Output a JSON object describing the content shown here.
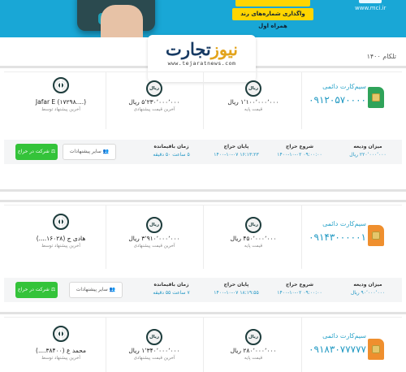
{
  "banner": {
    "promo_text": "واگذاری شماره‌های رند همراه اول",
    "site": "www.mci.ir"
  },
  "logo": {
    "main_left": "تجارت",
    "main_right": "نیوز",
    "sub": "www.tejaratnews.com"
  },
  "page": {
    "year_label": "تلکام ۱۴۰۰"
  },
  "labels": {
    "base_price": "قیمت پایه",
    "last_offer": "آخرین قیمت پیشنهادی",
    "last_offer_by": "آخرین پیشنهاد توسط",
    "deposit": "میزان ودیعه",
    "auction_start": "شروع حراج",
    "auction_end": "پایان حراج",
    "time_left": "زمان باقیمانده",
    "other_offers_button": "سایر پیشنهادات",
    "join_auction_button": "شرکت در حراج",
    "rial_icon_text": "ریال"
  },
  "cards": [
    {
      "sim_type": "سیم‌کارت دائمی",
      "sim_number": "۰۹۱۲۰۵۷۰۰۰۰",
      "base_price": "۱٬۱۰۰٬۰۰۰٬۰۰۰ ریال",
      "last_offer": "۵٬۲۳۰٬۰۰۰٬۰۰۰ ریال",
      "bidder": "Jafar E (۱۷۲۹۸....)",
      "deposit": "۲۲۰٬۰۰۰٬۰۰۰ ریال",
      "start": "۰۹:۰۰:۰۰ ۱۴۰۰-۱۰-۰۲",
      "end": "۱۶:۱۳:۲۳ ۱۴۰۰-۱۰-۰۷",
      "time_left": "۵ ساعت ۵۰ دقیقه",
      "sim_color": "green"
    },
    {
      "sim_type": "سیم‌کارت دائمی",
      "sim_number": "۰۹۱۴۳۰۰۰۰۰۱",
      "base_price": "۴۵۰٬۰۰۰٬۰۰۰ ریال",
      "last_offer": "۳٬۹۱۰٬۰۰۰٬۰۰۰ ریال",
      "bidder": "هادی ج (۱۶۰۲۸....)",
      "deposit": "۹۰٬۰۰۰٬۰۰۰ ریال",
      "start": "۰۹:۰۰:۰۰ ۱۴۰۰-۱۰-۰۲",
      "end": "۱۸:۱۹:۵۵ ۱۴۰۰-۱۰-۰۷",
      "time_left": "۷ ساعت ۵۵ دقیقه",
      "sim_color": "orange"
    },
    {
      "sim_type": "سیم‌کارت دائمی",
      "sim_number": "۰۹۱۸۳۰۷۷۷۷۷",
      "base_price": "۲۸۰٬۰۰۰٬۰۰۰ ریال",
      "last_offer": "۱٬۳۴۰٬۰۰۰٬۰۰۰ ریال",
      "bidder": "محمد ع (۳۸۴۰۰....)",
      "sim_color": "orange"
    }
  ]
}
